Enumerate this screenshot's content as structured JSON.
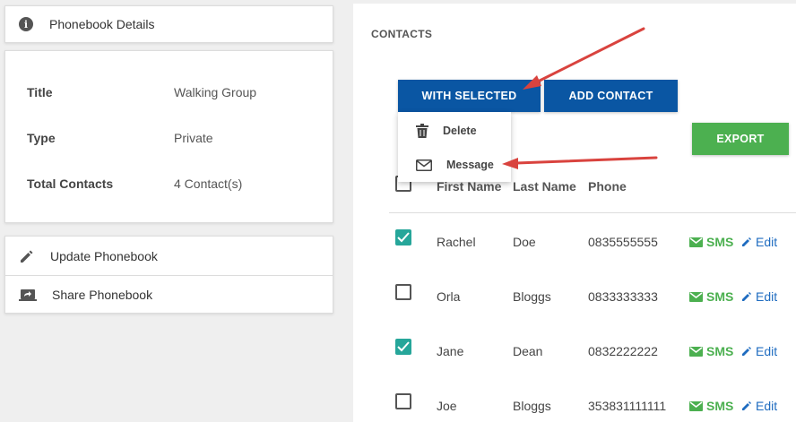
{
  "sidebar": {
    "header_title": "Phonebook Details",
    "details": [
      {
        "key": "Title",
        "value": "Walking Group"
      },
      {
        "key": "Type",
        "value": "Private"
      },
      {
        "key": "Total Contacts",
        "value": "4 Contact(s)"
      }
    ],
    "actions": [
      {
        "label": "Update Phonebook",
        "icon": "pencil-icon"
      },
      {
        "label": "Share Phonebook",
        "icon": "share-screen-icon"
      }
    ]
  },
  "contacts": {
    "title": "CONTACTS",
    "with_selected_label": "WITH SELECTED",
    "add_contact_label": "ADD CONTACT",
    "export_label": "EXPORT",
    "dropdown": [
      {
        "label": "Delete",
        "icon": "trash-icon"
      },
      {
        "label": "Message",
        "icon": "envelope-icon"
      }
    ],
    "columns": [
      "First Name",
      "Last Name",
      "Phone"
    ],
    "rows": [
      {
        "first": "Rachel",
        "last": "Doe",
        "phone": "0835555555",
        "checked": true,
        "sms": "SMS",
        "edit": "Edit"
      },
      {
        "first": "Orla",
        "last": "Bloggs",
        "phone": "0833333333",
        "checked": false,
        "sms": "SMS",
        "edit": "Edit"
      },
      {
        "first": "Jane",
        "last": "Dean",
        "phone": "0832222222",
        "checked": true,
        "sms": "SMS",
        "edit": "Edit"
      },
      {
        "first": "Joe",
        "last": "Bloggs",
        "phone": "353831111111",
        "checked": false,
        "sms": "SMS",
        "edit": "Edit"
      }
    ]
  },
  "colors": {
    "primary": "#0a56a3",
    "success": "#4cb050",
    "checked": "#26a69a",
    "annotation": "#d9433e"
  }
}
